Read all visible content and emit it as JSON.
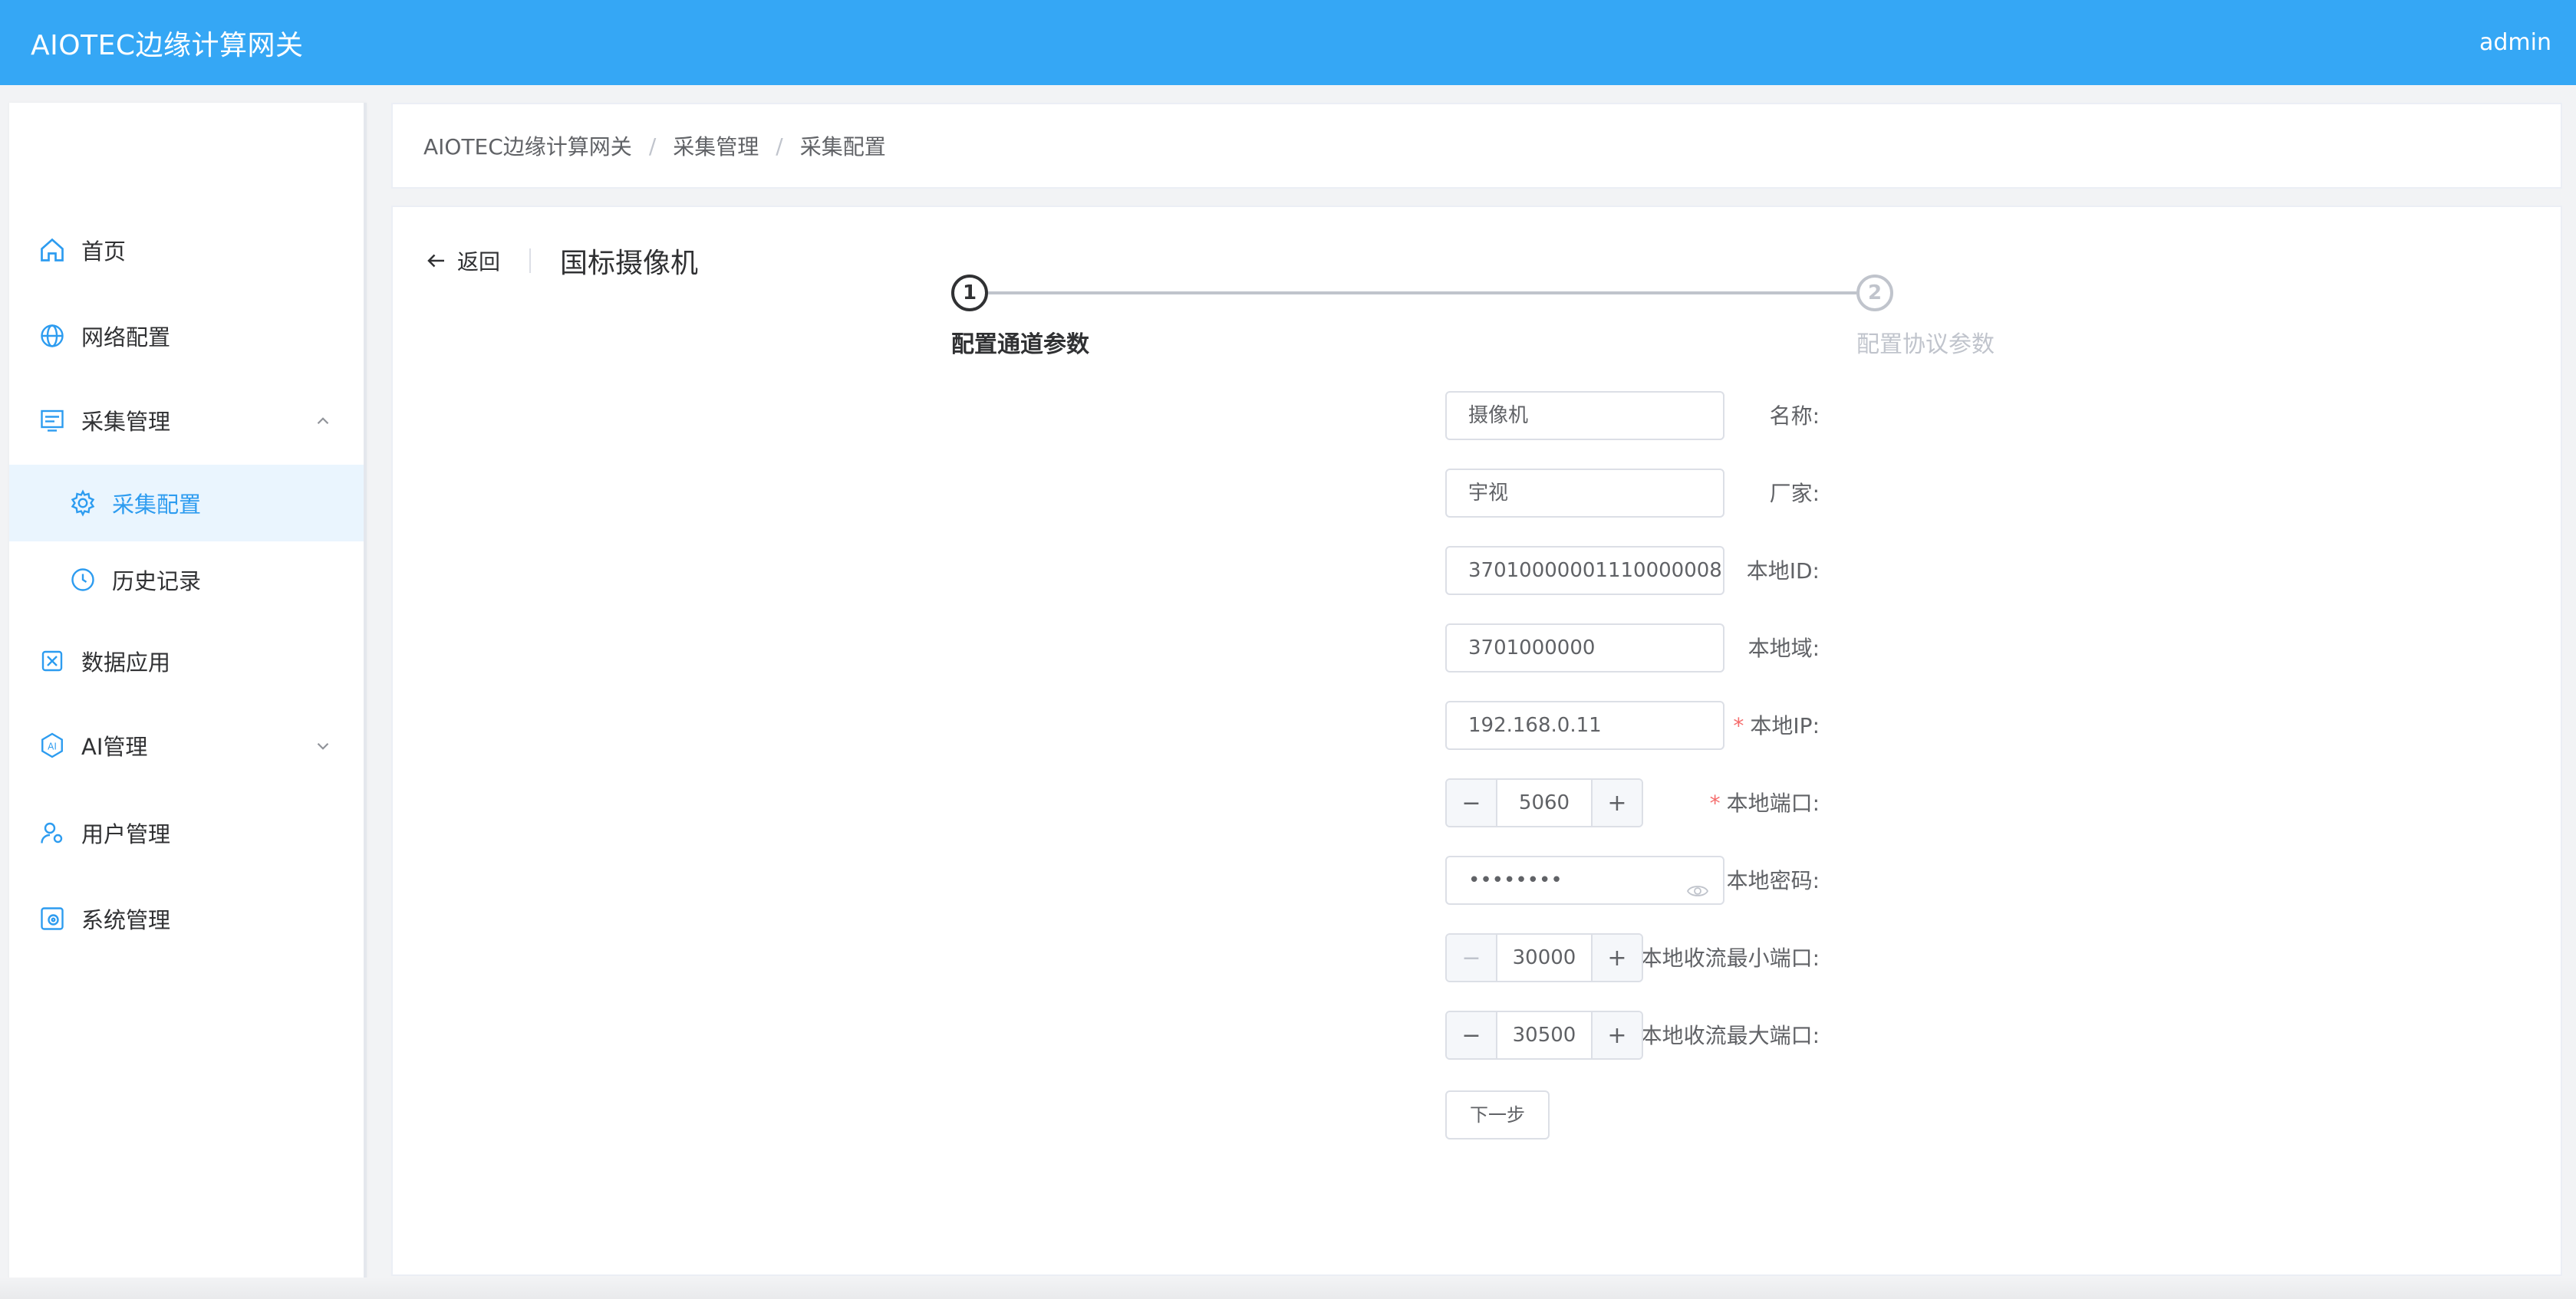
{
  "header": {
    "app_title": "AIOTEC边缘计算网关",
    "user": "admin",
    "bg_color": "#35a7f5"
  },
  "sidebar": {
    "items": [
      {
        "label": "首页",
        "icon": "home-icon"
      },
      {
        "label": "网络配置",
        "icon": "globe-icon"
      },
      {
        "label": "采集管理",
        "icon": "collect-icon",
        "expanded": true
      },
      {
        "label": "采集配置",
        "icon": "gear-icon",
        "active": true
      },
      {
        "label": "历史记录",
        "icon": "history-icon"
      },
      {
        "label": "数据应用",
        "icon": "data-app-icon"
      },
      {
        "label": "AI管理",
        "icon": "ai-icon",
        "expanded": false
      },
      {
        "label": "用户管理",
        "icon": "user-gear-icon"
      },
      {
        "label": "系统管理",
        "icon": "system-icon"
      }
    ]
  },
  "breadcrumb": [
    "AIOTEC边缘计算网关",
    "采集管理",
    "采集配置"
  ],
  "page": {
    "back_label": "返回",
    "title": "国标摄像机"
  },
  "steps": [
    {
      "number": "1",
      "title": "配置通道参数",
      "status": "active"
    },
    {
      "number": "2",
      "title": "配置协议参数",
      "status": "pending"
    }
  ],
  "form": {
    "name": {
      "label": "名称:",
      "value": "摄像机"
    },
    "vendor": {
      "label": "厂家:",
      "value": "宇视"
    },
    "local_id": {
      "label": "本地ID:",
      "value": "37010000001110000008"
    },
    "local_domain": {
      "label": "本地域:",
      "value": "3701000000"
    },
    "local_ip": {
      "label": "本地IP:",
      "value": "192.168.0.11",
      "required": true
    },
    "local_port": {
      "label": "本地端口:",
      "value": "5060",
      "required": true
    },
    "local_password": {
      "label": "本地密码:",
      "value": "••••••••",
      "required": true
    },
    "min_port": {
      "label": "本地收流最小端口:",
      "value": "30000",
      "required": true
    },
    "max_port": {
      "label": "本地收流最大端口:",
      "value": "30500",
      "required": true
    },
    "required_mark": "*",
    "minus": "−",
    "plus": "+",
    "next_label": "下一步"
  }
}
